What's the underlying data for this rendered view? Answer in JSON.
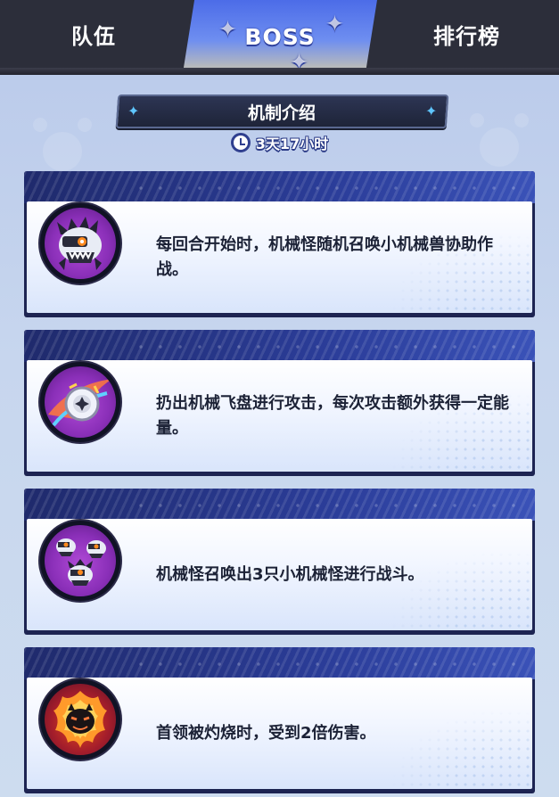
{
  "tabs": [
    {
      "label": "队伍",
      "active": false
    },
    {
      "label": "BOSS",
      "active": true
    },
    {
      "label": "排行榜",
      "active": false
    }
  ],
  "header": {
    "title": "机制介绍",
    "countdown": "3天17小时",
    "countdown_icon": "clock-icon"
  },
  "mechanics": [
    {
      "icon": "mecha-beast-icon",
      "description": "每回合开始时，机械怪随机召唤小机械兽协助作战。"
    },
    {
      "icon": "mecha-disc-icon",
      "description": "扔出机械飞盘进行攻击，每次攻击额外获得一定能量。"
    },
    {
      "icon": "mecha-minions-icon",
      "description": "机械怪召唤出3只小机械怪进行战斗。"
    },
    {
      "icon": "burning-boss-icon",
      "description": "首领被灼烧时，受到2倍伤害。"
    }
  ],
  "colors": {
    "tab_bar": "#2c2e3a",
    "active_tab": "#4c6ce8",
    "card_frame": "#1d2452",
    "card_text": "#1c2236",
    "background": "#c7d6ee"
  }
}
